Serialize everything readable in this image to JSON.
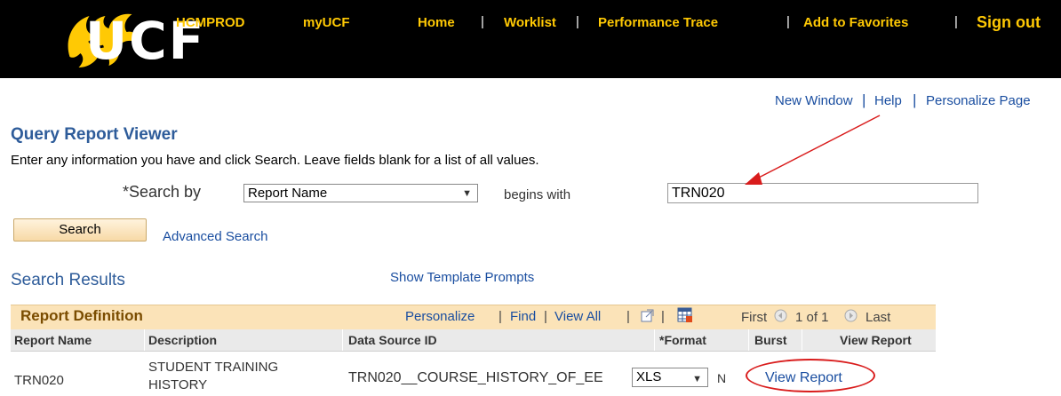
{
  "header": {
    "logo_text": "UCF",
    "nav": {
      "environment": "HCMPROD",
      "myucf": "myUCF",
      "home": "Home",
      "worklist": "Worklist",
      "performance_trace": "Performance Trace",
      "add_to_favorites": "Add to Favorites",
      "sign_out": "Sign out",
      "separator": "|"
    },
    "colors": {
      "background": "#000000",
      "link": "#ffc904"
    }
  },
  "top_links": {
    "new_window": "New Window",
    "help": "Help",
    "personalize_page": "Personalize Page",
    "separator": "|"
  },
  "page": {
    "title": "Query Report Viewer",
    "instructions": "Enter any information you have and click Search. Leave fields blank for a list of all values."
  },
  "search": {
    "search_by_label": "*Search by",
    "search_by_value": "Report Name",
    "operator_label": "begins with",
    "input_value": "TRN020",
    "search_button": "Search",
    "advanced_search": "Advanced Search"
  },
  "results": {
    "heading": "Search Results",
    "show_template_prompts": "Show Template Prompts",
    "grid": {
      "title": "Report Definition",
      "personalize": "Personalize",
      "find": "Find",
      "view_all": "View All",
      "separator": "|",
      "first": "First",
      "page_info": "1 of 1",
      "last": "Last",
      "icons": [
        "zoom-icon",
        "download-icon",
        "previous-icon",
        "next-icon"
      ],
      "columns": [
        "Report Name",
        "Description",
        "Data Source ID",
        "*Format",
        "Burst",
        "View Report"
      ],
      "rows": [
        {
          "report_name": "TRN020",
          "description_line1": "STUDENT TRAINING",
          "description_line2": "HISTORY",
          "data_source_id": "TRN020__COURSE_HISTORY_OF_EE",
          "format": "XLS",
          "burst": "N",
          "view_report": "View Report"
        }
      ]
    }
  },
  "annotation_color": "#d91c1c"
}
